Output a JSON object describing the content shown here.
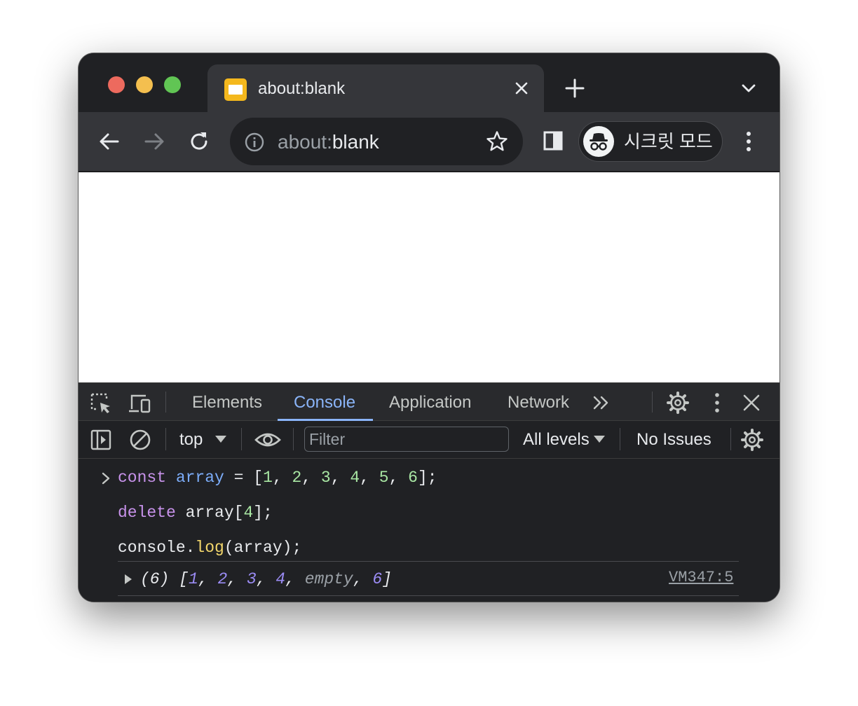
{
  "window": {
    "tab_title": "about:blank",
    "tab_favicon": "blank-page-icon"
  },
  "toolbar": {
    "url_scheme": "about:",
    "url_rest": "blank",
    "incognito_label": "시크릿 모드"
  },
  "devtools": {
    "tabs": [
      "Elements",
      "Console",
      "Application",
      "Network"
    ],
    "active_tab": "Console",
    "context": "top",
    "filter_placeholder": "Filter",
    "levels": "All levels",
    "issues": "No Issues"
  },
  "console": {
    "input_lines": [
      "const array = [1, 2, 3, 4, 5, 6];",
      "delete array[4];",
      "console.log(array);"
    ],
    "result": {
      "length": "(6)",
      "items": [
        "1",
        "2",
        "3",
        "4",
        "empty",
        "6"
      ]
    },
    "source_link": "VM347:5"
  },
  "colors": {
    "chrome_dark": "#202124",
    "toolbar": "#35363a",
    "accent_blue": "#8ab4f8"
  }
}
